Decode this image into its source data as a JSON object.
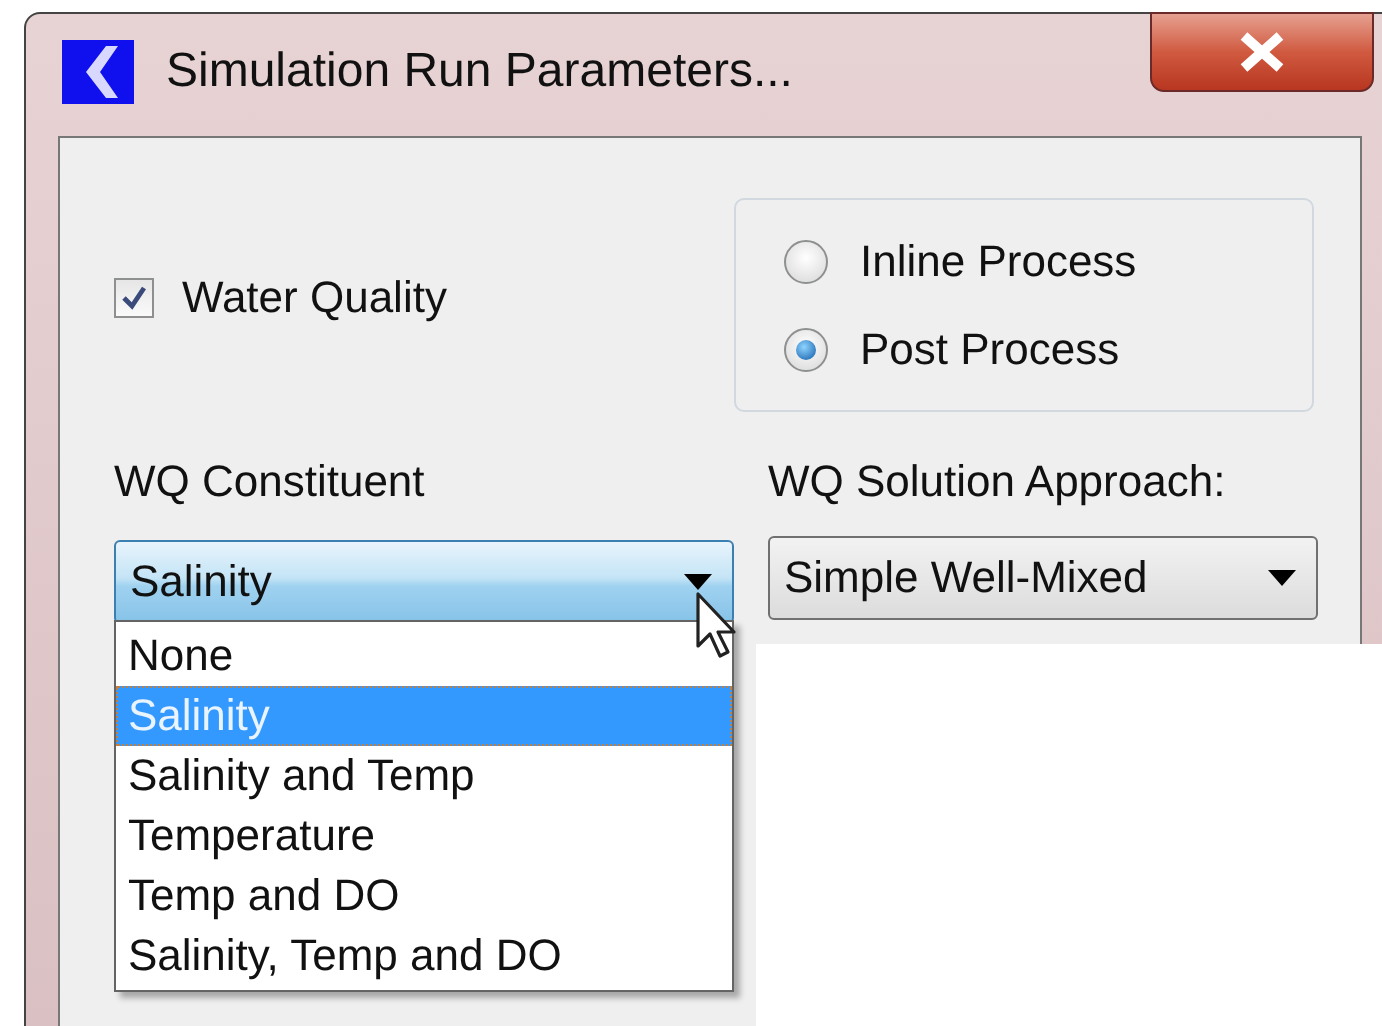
{
  "window": {
    "title": "Simulation Run Parameters..."
  },
  "water_quality": {
    "label": "Water Quality",
    "checked": true
  },
  "process_options": [
    {
      "label": "Inline Process",
      "selected": false
    },
    {
      "label": "Post Process",
      "selected": true
    }
  ],
  "wq_constituent": {
    "label": "WQ Constituent",
    "value": "Salinity",
    "open": true,
    "options": [
      {
        "label": "None",
        "selected": false
      },
      {
        "label": "Salinity",
        "selected": true
      },
      {
        "label": "Salinity and Temp",
        "selected": false
      },
      {
        "label": "Temperature",
        "selected": false
      },
      {
        "label": "Temp and DO",
        "selected": false
      },
      {
        "label": "Salinity, Temp and DO",
        "selected": false
      }
    ]
  },
  "wq_solution_approach": {
    "label": "WQ Solution Approach:",
    "value": "Simple Well-Mixed"
  }
}
